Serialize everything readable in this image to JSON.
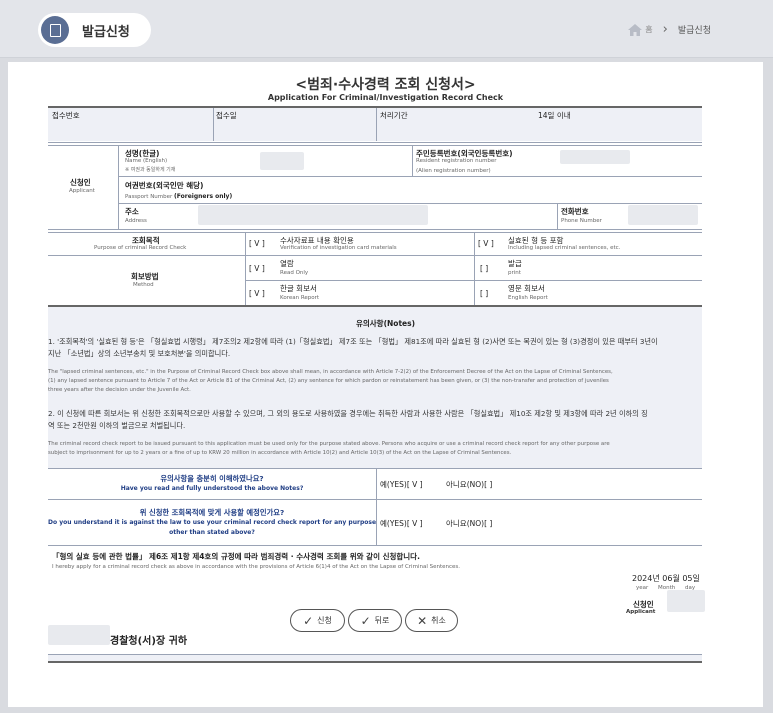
{
  "header": {
    "title": "발급신청",
    "breadcrumb": {
      "home": "홈",
      "separator": "›",
      "current": "발급신청"
    }
  },
  "form": {
    "title": "<범죄·수사경력 조회 신청서>",
    "subtitle": "Application For Criminal/Investigation Record Check",
    "receipt_no": "접수번호",
    "receipt_date": "접수일",
    "processing_period": "처리기간",
    "processing_value": "14일 이내",
    "applicant_ko": "신청인",
    "applicant_en": "Applicant",
    "name_ko": "성명(한글)",
    "name_en": "Name (English)",
    "name_note": "※ 여권과 동일하게 기재",
    "rrn_ko": "주민등록번호(외국인등록번호)",
    "rrn_en": "Resident registration number",
    "rrn_en2": "(Alien registration number)",
    "passport_ko": "여권번호(외국인만 해당)",
    "passport_en": "Passport Number",
    "passport_en_b": "(Foreigners only)",
    "address_ko": "주소",
    "address_en": "Address",
    "phone_ko": "전화번호",
    "phone_en": "Phone Number",
    "purpose_ko": "조회목적",
    "purpose_en": "Purpose of criminal Record Check",
    "purpose_opt1_mark": "[ V ]",
    "purpose_opt1_ko": "수사자료표 내용 확인용",
    "purpose_opt1_en": "Verification of investigation card materials",
    "purpose_opt2_mark": "[ V ]",
    "purpose_opt2_ko": "실효된 형 등 포함",
    "purpose_opt2_en": "Including lapsed criminal sentences, etc.",
    "method_ko": "회보방법",
    "method_en": "Method",
    "m1_mark": "[ V ]",
    "m1_ko": "열람",
    "m1_en": "Read Only",
    "m2_mark": "[ ]",
    "m2_ko": "발급",
    "m2_en": "print",
    "m3_mark": "[ V ]",
    "m3_ko": "한글 회보서",
    "m3_en": "Korean Report",
    "m4_mark": "[ ]",
    "m4_ko": "영문 회보서",
    "m4_en": "English Report"
  },
  "notes": {
    "header": "유의사항(Notes)",
    "n1_ko_a": "1. '조회목적'의 '실효된 형 등'은 「형실효법 시행령」 제7조의2 제2항에 따라 (1)「형실효법」 제7조 또는 「형법」 제81조에 따라 실효된 형 (2)사면 또는 복권이 있는 형 (3)경정이 있은 때부터 3년이",
    "n1_ko_b": "지난 「소년법」상의 소년부송치 및 보호처분'을 의미합니다.",
    "n1_en_a": "The \"lapsed criminal sentences, etc.\" in the Purpose of Criminal Record Check box above shall mean, in accordance with Article 7-2(2) of the Enforcement Decree of the Act on the Lapse of Criminal Sentences,",
    "n1_en_b": "(1) any lapsed sentence pursuant to Article 7 of the Act or Article 81 of the Criminal Act, (2) any sentence for which pardon or reinstatement has been given, or (3) the non-transfer and protection of juveniles",
    "n1_en_c": "three years after the decision under the Juvenile Act.",
    "n2_ko_a": "2. 이 신청에 따른 회보서는 위 신청한 조회목적으로만 사용할 수 있으며, 그 외의 용도로 사용하였을 경우에는 취득한 사람과 사용한 사람은 「형실효법」 제10조 제2항 및 제3항에 따라 2년 이하의 징",
    "n2_ko_b": "역 또는 2천만원 이하의 벌금으로 처벌됩니다.",
    "n2_en_a": "The criminal record check report to be issued pursuant to this application must be used only for the purpose stated above. Persons who acquire or use a criminal record check report for any other purpose are",
    "n2_en_b": "subject to imprisonment for up to 2 years or a fine of up to KRW 20 million in accordance with Article 10(2) and Article 10(3) of the Act on the Lapse of Criminal Sentences."
  },
  "questions": {
    "q1_ko": "유의사항을 충분히 이해하였나요?",
    "q1_en": "Have you read and fully understood the above Notes?",
    "q1_yes": "예(YES)[ V ]",
    "q1_no": "아니요(NO)[ ]",
    "q2_ko": "위 신청한 조회목적에 맞게 사용할 예정인가요?",
    "q2_en_a": "Do you understand it is against the law to use your criminal record check report for any purpose",
    "q2_en_b": "other than stated above?",
    "q2_yes": "예(YES)[ V ]",
    "q2_no": "아니요(NO)[ ]"
  },
  "declaration": {
    "ko": "「형의 실효 등에 관한 법률」 제6조 제1항 제4호의 규정에 따라 범죄경력 · 수사경력 조회를 위와 같이 신청합니다.",
    "en": "I hereby apply for a criminal record check as above in accordance with the provisions of Article 6(1)4 of the Act on the Lapse of Criminal Sentences.",
    "date": "2024년 06월 05일",
    "date_en_year": "year",
    "date_en_month": "Month",
    "date_en_day": "day",
    "applicant_ko": "신청인",
    "applicant_en": "Applicant",
    "addressee": "경찰청(서)장 귀하"
  },
  "buttons": {
    "apply": "신청",
    "back": "뒤로",
    "cancel": "취소"
  },
  "colors": {
    "accent": "#5a6e94",
    "question_text": "#1f3d84",
    "row_bg": "#eef0f6"
  }
}
